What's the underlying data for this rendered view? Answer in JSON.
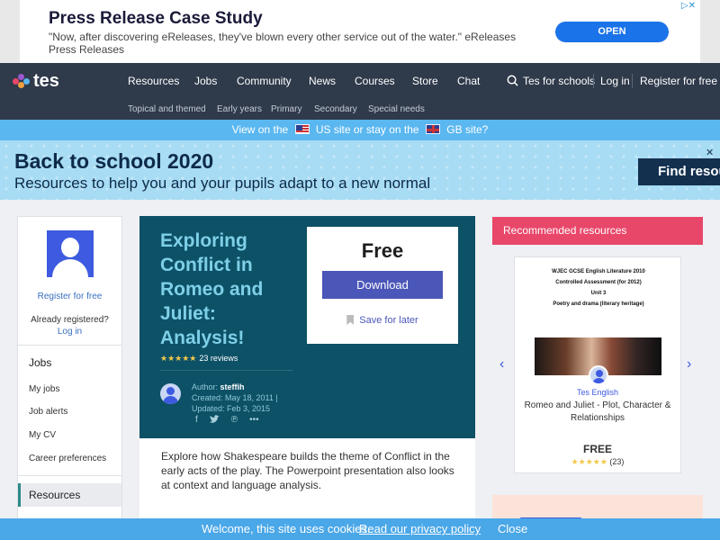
{
  "ad": {
    "title": "Press Release Case Study",
    "text": "\"Now, after discovering eReleases, they've blown every other service out of the water.\" eReleases Press Releases",
    "cta": "OPEN",
    "badge": "▷✕"
  },
  "nav": {
    "logo": "tes",
    "main": [
      "Resources",
      "Jobs",
      "Community",
      "News",
      "Courses",
      "Store",
      "Chat"
    ],
    "schools": "Tes for schools",
    "login": "Log in",
    "register": "Register for free",
    "sub": [
      "Topical and themed",
      "Early years",
      "Primary",
      "Secondary",
      "Special needs"
    ]
  },
  "switch": {
    "prefix": "View on the",
    "us": "US site or stay on the",
    "gb": "GB site?"
  },
  "banner": {
    "title": "Back to school 2020",
    "subtitle": "Resources to help you and your pupils adapt to a new normal",
    "cta": "Find resou",
    "close": "✕"
  },
  "sidebar": {
    "register": "Register for free",
    "already": "Already registered?",
    "login": "Log in",
    "jobs_heading": "Jobs",
    "items": [
      "My jobs",
      "Job alerts",
      "My CV",
      "Career preferences"
    ],
    "active": "Resources"
  },
  "resource": {
    "title": "Exploring Conflict in Romeo and Juliet: Analysis!",
    "stars": "★★★★★",
    "reviews": "23 reviews",
    "author_label": "Author:",
    "author": "steffih",
    "created": "Created: May 18, 2011",
    "updated": "Updated: Feb 3, 2015",
    "price": "Free",
    "download": "Download",
    "save": "Save for later",
    "description": "Explore how Shakespeare builds the theme of Conflict in the early acts of the play. The Powerpoint presentation also looks at context and language analysis."
  },
  "recommended": {
    "heading": "Recommended resources",
    "doc_lines": [
      "WJEC GCSE English Literature 2010",
      "Controlled Assessment (for 2012)",
      "Unit 3",
      "Poetry and drama (literary heritage)"
    ],
    "author": "Tes English",
    "title": "Romeo and Juliet - Plot, Character & Relationships",
    "price": "FREE",
    "stars": "★★★★★",
    "count": "(23)",
    "prev": "‹",
    "next": "›"
  },
  "cookie": {
    "text": "Welcome, this site uses cookies.",
    "link": "Read our privacy policy",
    "close": "Close"
  },
  "colors": {
    "nav_bg": "#2f3a4b",
    "hero_bg": "#0d5167",
    "accent_pink": "#e8476a",
    "button_blue": "#4a56b8",
    "cookie_bg": "#4aa7e8"
  }
}
